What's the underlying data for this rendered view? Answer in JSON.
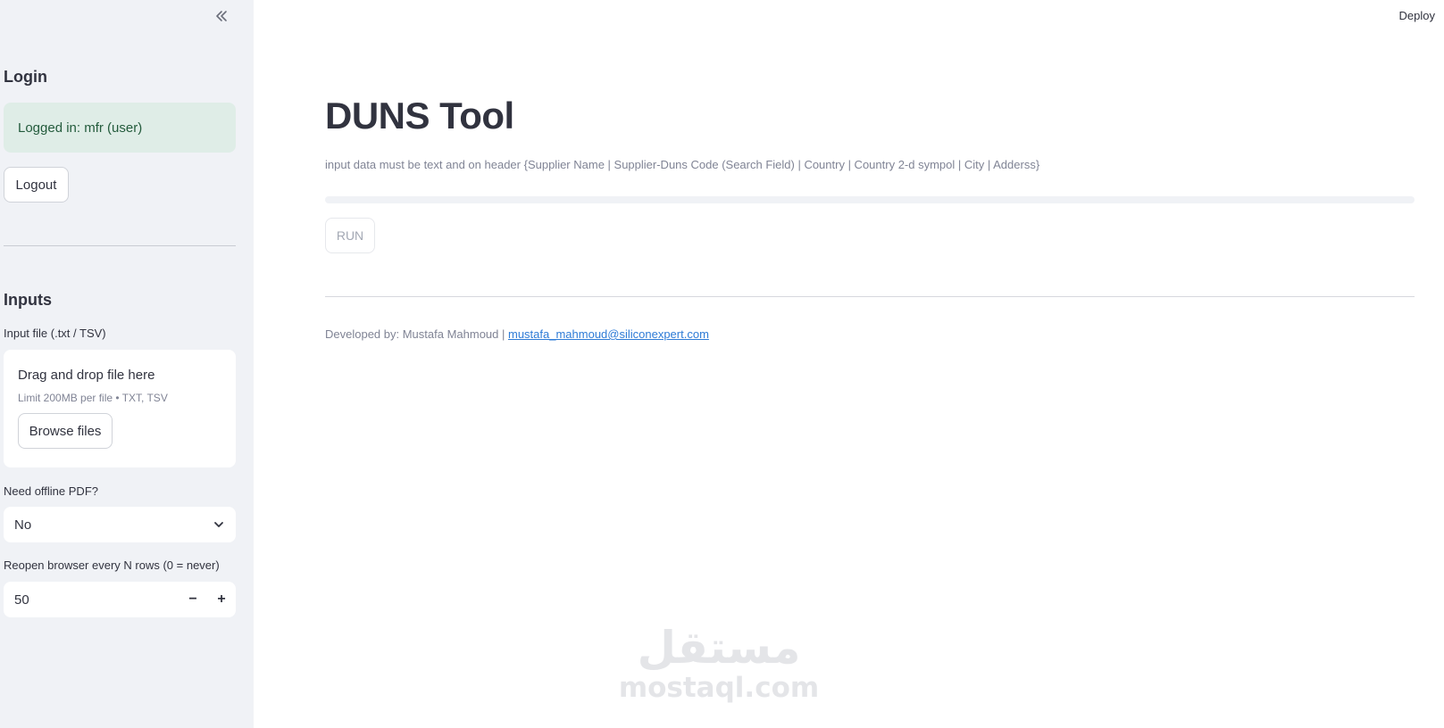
{
  "sidebar": {
    "login_heading": "Login",
    "login_status": "Logged in: mfr (user)",
    "logout_label": "Logout",
    "inputs_heading": "Inputs",
    "file_label": "Input file (.txt / TSV)",
    "dropzone_title": "Drag and drop file here",
    "dropzone_limit": "Limit 200MB per file • TXT, TSV",
    "browse_label": "Browse files",
    "pdf_label": "Need offline PDF?",
    "pdf_value": "No",
    "reopen_label": "Reopen browser every N rows (0 = never)",
    "reopen_value": "50",
    "minus": "−",
    "plus": "+"
  },
  "header": {
    "deploy_label": "Deploy"
  },
  "main": {
    "title": "DUNS Tool",
    "caption": "input data must be text and on header {Supplier Name | Supplier-Duns Code (Search Field) | Country | Country 2-d sympol | City | Adderss}",
    "progress": 0,
    "run_label": "RUN",
    "footer_text": "Developed by: Mustafa Mahmoud |",
    "footer_email": "mustafa_mahmoud@siliconexpert.com"
  },
  "watermark": {
    "arabic": "مستقل",
    "latin": "mostaql.com"
  },
  "colors": {
    "sidebar_bg": "#f0f2f6",
    "success_bg": "#dfede7",
    "success_text": "#235b3c",
    "link": "#2e7bd6"
  }
}
